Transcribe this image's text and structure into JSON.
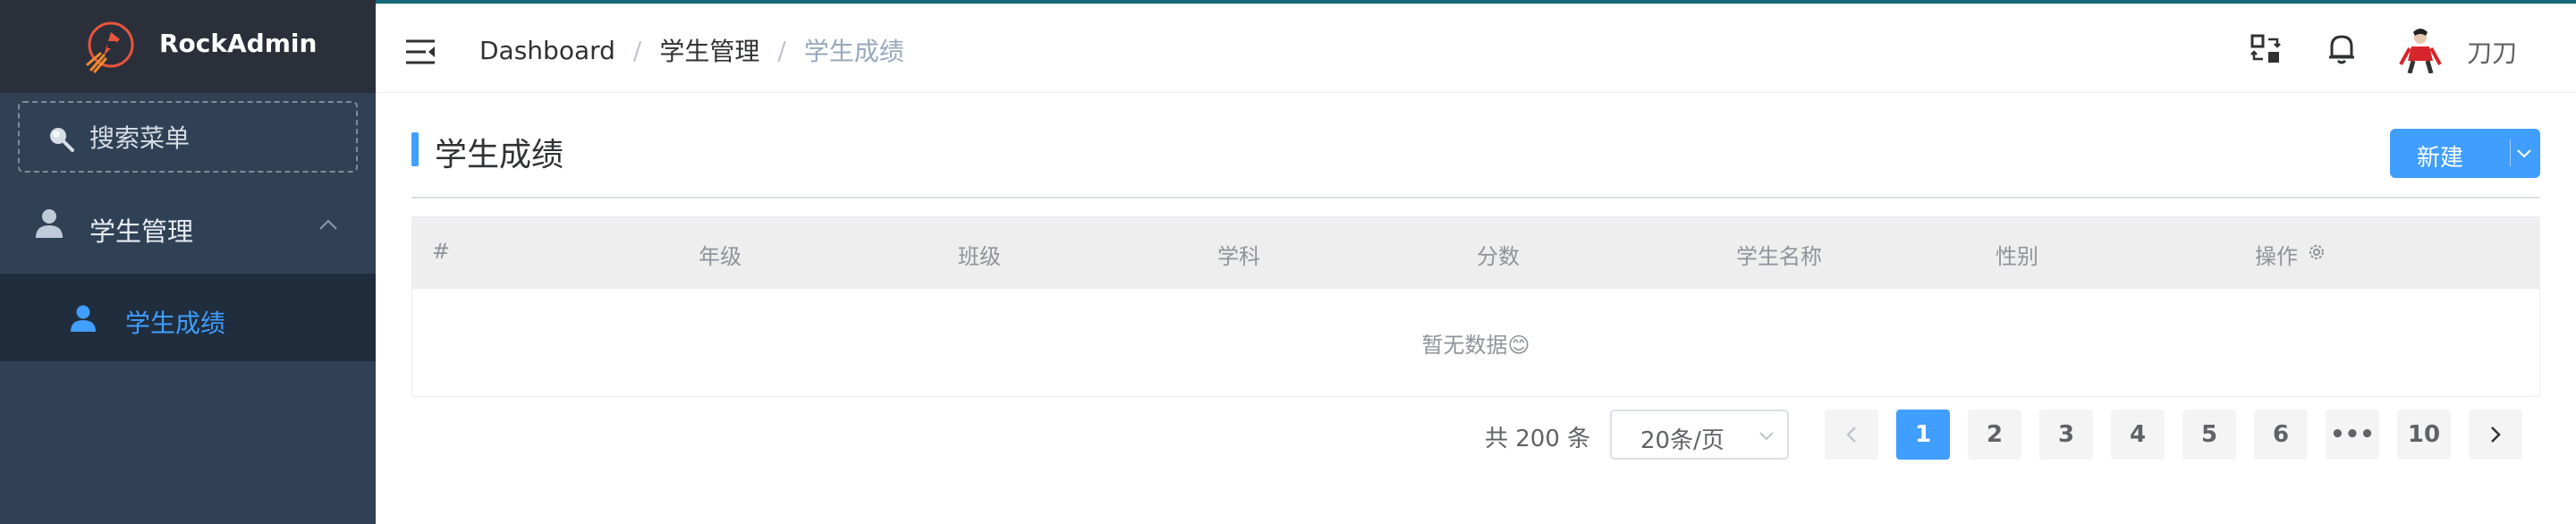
{
  "brand": {
    "name": "RockAdmin"
  },
  "sidebar": {
    "search_placeholder": "搜索菜单",
    "group": {
      "label": "学生管理",
      "icon": "user-icon",
      "expanded": true
    },
    "active_item": {
      "label": "学生成绩",
      "icon": "user-icon"
    }
  },
  "header": {
    "breadcrumb": [
      "Dashboard",
      "学生管理",
      "学生成绩"
    ],
    "username": "刀刀"
  },
  "main": {
    "title": "学生成绩",
    "new_button": "新建",
    "table": {
      "columns": [
        "#",
        "年级",
        "班级",
        "学科",
        "分数",
        "学生名称",
        "性别",
        "操作"
      ],
      "empty_text": "暂无数据😊"
    },
    "pagination": {
      "total_text": "共 200 条",
      "page_size": "20条/页",
      "pages": [
        "1",
        "2",
        "3",
        "4",
        "5",
        "6",
        "•••",
        "10"
      ],
      "current": "1"
    }
  },
  "colors": {
    "accent": "#409eff",
    "sidebar_bg": "#304156",
    "logo_bg": "#2b2f3a",
    "submenu_bg": "#1f2d3d",
    "topline": "#14697a"
  }
}
